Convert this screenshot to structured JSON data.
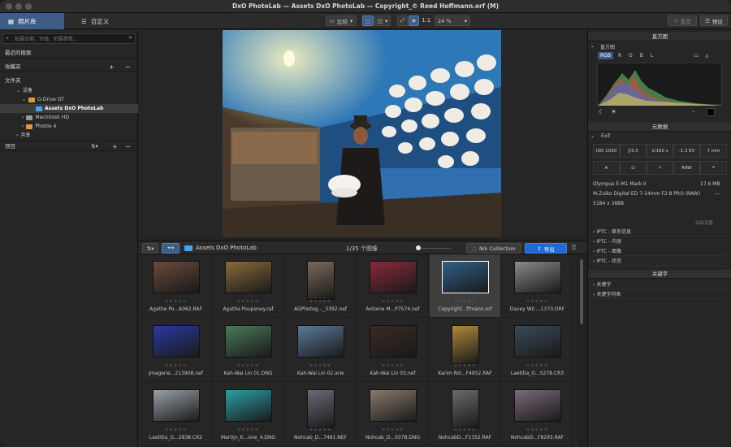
{
  "window": {
    "title": "DxO PhotoLab — Assets DxO PhotoLab — Copyright_© Reed Hoffmann.orf (M)"
  },
  "toolbar": {
    "tabs": [
      {
        "label": "照片库",
        "active": true
      },
      {
        "label": "自定义",
        "active": false
      }
    ],
    "compare_label": "比较",
    "zoom_1to1": "1:1",
    "zoom_level": "24 %",
    "reset_label": "重置",
    "preset_label": "预设"
  },
  "left_panel": {
    "search_placeholder": "拍摄日期、评级、拍摄参数…",
    "recent_searches": "最近的搜索",
    "favorites": "收藏夹",
    "folders": "文件夹",
    "tree": [
      {
        "label": "设备",
        "level": 1
      },
      {
        "label": "G-Drive GT",
        "level": 2
      },
      {
        "label": "Assets DxO PhotoLab",
        "level": 3,
        "selected": true
      },
      {
        "label": "Macintosh HD",
        "level": 2
      },
      {
        "label": "Photos 4",
        "level": 2
      },
      {
        "label": "共享",
        "level": 1
      }
    ],
    "projects": "项目"
  },
  "filmstrip": {
    "folder_name": "Assets DxO PhotoLab",
    "count_label": "1/35 个图像",
    "nik_label": "Nik Collection",
    "export_label": "导出",
    "items": [
      {
        "name": "Agathe Po...A062.RAF",
        "color": "#6b4a3a",
        "w": 58,
        "h": 40,
        "selected": false
      },
      {
        "name": "Agathe Poupeney.raf",
        "color": "#8a6a3a",
        "w": 58,
        "h": 40,
        "selected": false
      },
      {
        "name": "AGPhotog..._3392.nef",
        "color": "#7a6a5a",
        "w": 34,
        "h": 48,
        "selected": false
      },
      {
        "name": "Antoine M...P7574.nef",
        "color": "#8a2a3a",
        "w": 58,
        "h": 40,
        "selected": false
      },
      {
        "name": "Copyright...ffmann.orf",
        "color": "#2f5f8a",
        "w": 58,
        "h": 40,
        "selected": true
      },
      {
        "name": "Davey Wil...-1370.ORF",
        "color": "#8a8a8a",
        "w": 58,
        "h": 40,
        "selected": false
      },
      {
        "name": "Jmagerie...213908.nef",
        "color": "#2a3aa0",
        "w": 58,
        "h": 40,
        "selected": false
      },
      {
        "name": "Kah-Wai Lin 01.DNG",
        "color": "#4a7a5a",
        "w": 58,
        "h": 40,
        "selected": false
      },
      {
        "name": "Kah-Wai Lin 02.arw",
        "color": "#5a7a9a",
        "w": 58,
        "h": 40,
        "selected": false
      },
      {
        "name": "Kah-Wai Lin 03.nef",
        "color": "#3a2a22",
        "w": 58,
        "h": 40,
        "selected": false
      },
      {
        "name": "Karim Rol...F4952.RAF",
        "color": "#b08a3a",
        "w": 34,
        "h": 48,
        "selected": false
      },
      {
        "name": "Laetitia_G...5278.CR3",
        "color": "#3a4a5a",
        "w": 58,
        "h": 40,
        "selected": false
      },
      {
        "name": "Laetitia_G...2838.CR2",
        "color": "#9aa0a8",
        "w": 58,
        "h": 40,
        "selected": false
      },
      {
        "name": "Martijn_K...one_4.DNG",
        "color": "#2aa0a8",
        "w": 58,
        "h": 40,
        "selected": false
      },
      {
        "name": "Nohcab_D...7491.NEF",
        "color": "#6a6a7a",
        "w": 34,
        "h": 48,
        "selected": false
      },
      {
        "name": "Nohcab_D...0378.DNG",
        "color": "#8a7a6a",
        "w": 58,
        "h": 40,
        "selected": false
      },
      {
        "name": "NohcabD...F1352.RAF",
        "color": "#6a6a6a",
        "w": 34,
        "h": 48,
        "selected": false
      },
      {
        "name": "NohcabD...F8293.RAF",
        "color": "#7a6a7a",
        "w": 58,
        "h": 40,
        "selected": false
      }
    ]
  },
  "right_panel": {
    "histogram_title": "直方图",
    "channels": [
      "RGB",
      "R",
      "G",
      "B",
      "L"
    ],
    "metadata_title": "元数据",
    "exif_label": "Exif",
    "exif_row1": [
      "ISO 1000",
      "ƒ/3.5",
      "1/160 s",
      "-1.3 EV",
      "7 mm"
    ],
    "exif_row2": [
      "A",
      "",
      "",
      "RAW",
      ""
    ],
    "camera": "Olympus E-M1 Mark II",
    "file_size": "17,6 MB",
    "lens": "M.Zuiko Digital ED 7-14mm F2.8 PRO (RAW)",
    "lens_extra": "—",
    "dimensions": "5184 x 3888",
    "advanced_settings": "高级设置",
    "iptc": [
      "IPTC - 联系信息",
      "IPTC - 内容",
      "IPTC - 图像",
      "IPTC - 状态"
    ],
    "keywords_title": "关键字",
    "keywords_items": [
      "关键字",
      "关键字列表"
    ]
  }
}
